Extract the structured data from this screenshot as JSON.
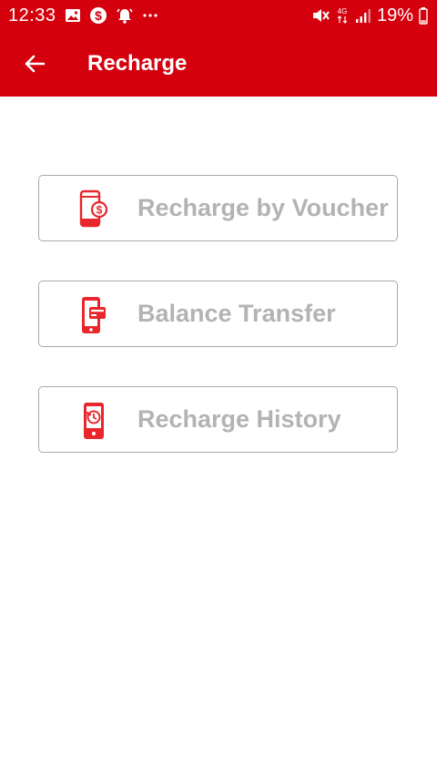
{
  "status_bar": {
    "time": "12:33",
    "network": "4G",
    "battery": "19%",
    "left_icons": [
      "image-icon",
      "dollar-icon",
      "alarm-icon",
      "more-dots-icon"
    ],
    "right_icons": [
      "mute-icon",
      "network-4g-icon",
      "signal-icon",
      "battery-icon"
    ]
  },
  "app_bar": {
    "title": "Recharge",
    "background": "#d4000d"
  },
  "menu": {
    "items": [
      {
        "label": "Recharge by Voucher",
        "icon": "phone-coin-icon"
      },
      {
        "label": "Balance Transfer",
        "icon": "phone-card-icon"
      },
      {
        "label": "Recharge History",
        "icon": "phone-history-icon"
      }
    ]
  },
  "colors": {
    "accent": "#d4000d",
    "icon": "#e8262b",
    "label": "#b3b3b3",
    "border": "#a9a9a9"
  }
}
